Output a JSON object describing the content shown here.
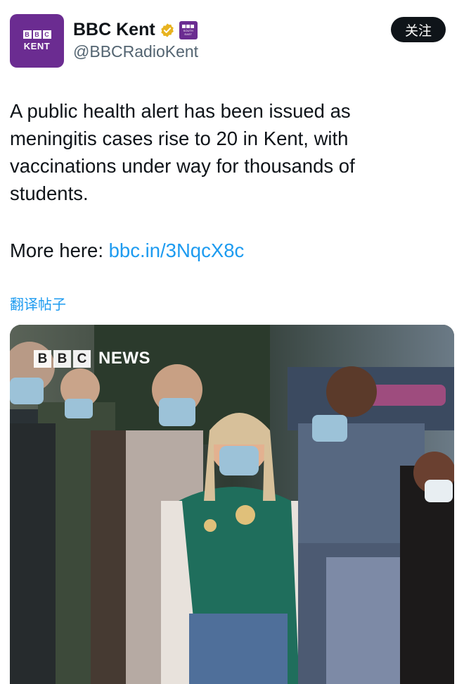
{
  "account": {
    "avatar_blocks": [
      "B",
      "B",
      "C"
    ],
    "avatar_sub": "KENT",
    "display_name": "BBC Kent",
    "handle": "@BBCRadioKent",
    "follow_label": "关注",
    "verified_color": "#e8b320",
    "brand_color": "#6b2c91"
  },
  "tweet": {
    "text": "A public health alert has been issued as meningitis cases rise to 20 in Kent, with vaccinations under way for thousands of students.",
    "more_prefix": "More here: ",
    "link_text": "bbc.in/3NqcX8c",
    "translate_label": "翻译帖子"
  },
  "media": {
    "logo_blocks": [
      "B",
      "B",
      "C"
    ],
    "logo_word": "NEWS",
    "description_icon": "photo-people-in-masks"
  }
}
